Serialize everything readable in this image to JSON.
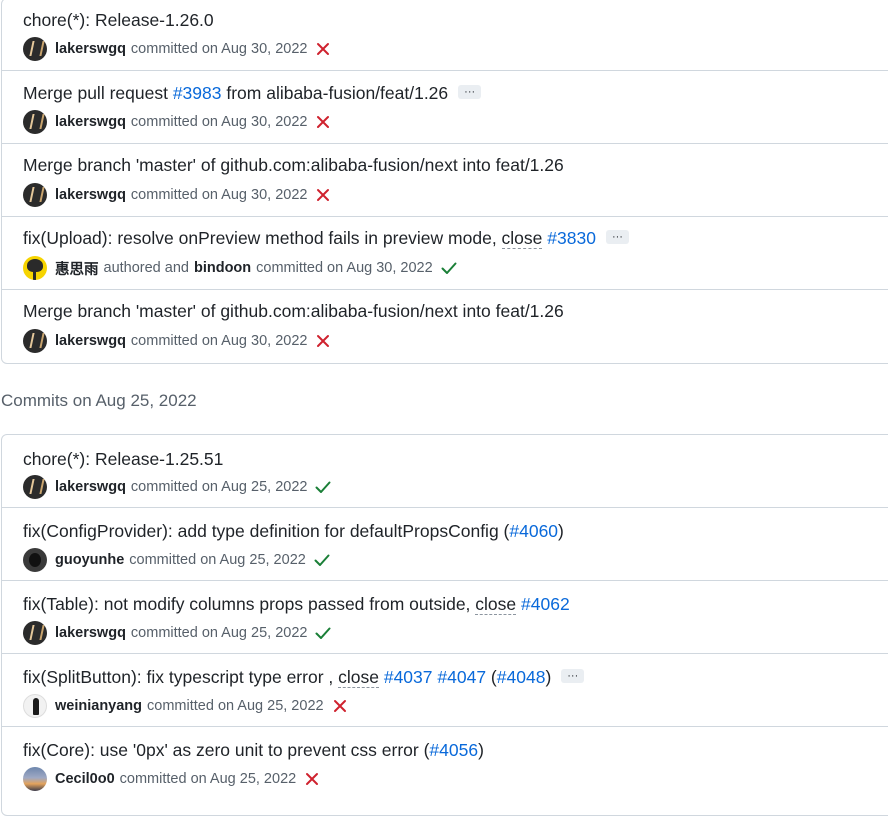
{
  "colors": {
    "link": "#0969da",
    "fail": "#cf222e",
    "success": "#1a7f37",
    "muted": "#57606a",
    "border": "#d0d7de"
  },
  "group1": {
    "commits": [
      {
        "title_parts": [
          "chore(*): Release-1.26.0"
        ],
        "author": "lakerswgq",
        "action": "committed on Aug 30, 2022",
        "status": "fail",
        "avatar_icon": "lakers-avatar-icon"
      },
      {
        "title_parts": [
          "Merge pull request ",
          "#3983",
          " from alibaba-fusion/feat/1.26"
        ],
        "ellipsis": "···",
        "author": "lakerswgq",
        "action": "committed on Aug 30, 2022",
        "status": "fail",
        "avatar_icon": "lakers-avatar-icon"
      },
      {
        "title_parts": [
          "Merge branch 'master' of github.com:alibaba-fusion/next into feat/1.26"
        ],
        "author": "lakerswgq",
        "action": "committed on Aug 30, 2022",
        "status": "fail",
        "avatar_icon": "lakers-avatar-icon"
      },
      {
        "title_parts": [
          "fix(Upload): resolve onPreview method fails in preview mode, ",
          "close",
          " ",
          "#3830"
        ],
        "ellipsis": "···",
        "author": "惠思雨",
        "authored_text": "authored and",
        "committer": "bindoon",
        "action": "committed on Aug 30, 2022",
        "status": "success",
        "avatar_icon": "tree-avatar-icon"
      },
      {
        "title_parts": [
          "Merge branch 'master' of github.com:alibaba-fusion/next into feat/1.26"
        ],
        "author": "lakerswgq",
        "action": "committed on Aug 30, 2022",
        "status": "fail",
        "avatar_icon": "lakers-avatar-icon"
      }
    ]
  },
  "group2": {
    "heading": "Commits on Aug 25, 2022",
    "commits": [
      {
        "title_parts": [
          "chore(*): Release-1.25.51"
        ],
        "author": "lakerswgq",
        "action": "committed on Aug 25, 2022",
        "status": "success"
      },
      {
        "title_parts": [
          "fix(ConfigProvider): add type definition for defaultPropsConfig (",
          "#4060",
          ")"
        ],
        "author": "guoyunhe",
        "action": "committed on Aug 25, 2022",
        "status": "success"
      },
      {
        "title_parts": [
          "fix(Table): not modify columns props passed from outside, ",
          "close",
          " ",
          "#4062"
        ],
        "author": "lakerswgq",
        "action": "committed on Aug 25, 2022",
        "status": "success"
      },
      {
        "title_parts": [
          "fix(SplitButton): fix typescript type error , ",
          "close",
          " ",
          "#4037",
          " ",
          "#4047",
          " (",
          "#4048",
          ")"
        ],
        "ellipsis": "···",
        "author": "weinianyang",
        "action": "committed on Aug 25, 2022",
        "status": "fail"
      },
      {
        "title_parts": [
          "fix(Core): use '0px' as zero unit to prevent css error (",
          "#4056",
          ")"
        ],
        "author": "Cecil0o0",
        "action": "committed on Aug 25, 2022",
        "status": "fail"
      }
    ]
  }
}
